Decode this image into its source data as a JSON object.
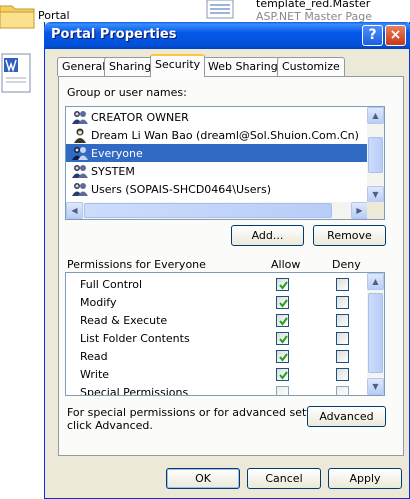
{
  "background": {
    "folder_label": "Portal",
    "file_name": "template_red.Master",
    "file_type": "ASP.NET Master Page"
  },
  "dialog": {
    "title": "Portal Properties",
    "help_glyph": "?",
    "close_glyph": "×"
  },
  "tabs": [
    {
      "label": "General",
      "active": false
    },
    {
      "label": "Sharing",
      "active": false
    },
    {
      "label": "Security",
      "active": true
    },
    {
      "label": "Web Sharing",
      "active": false
    },
    {
      "label": "Customize",
      "active": false
    }
  ],
  "security": {
    "group_label": "Group or user names:",
    "users": [
      {
        "name": "CREATOR OWNER",
        "icon": "users-group-icon",
        "selected": false
      },
      {
        "name": "Dream Li Wan Bao (dreaml@Sol.Shuion.Com.Cn)",
        "icon": "user-icon",
        "selected": false
      },
      {
        "name": "Everyone",
        "icon": "users-group-icon",
        "selected": true
      },
      {
        "name": "SYSTEM",
        "icon": "users-group-icon",
        "selected": false
      },
      {
        "name": "Users (SOPAIS-SHCD0464\\Users)",
        "icon": "users-group-icon",
        "selected": false
      }
    ],
    "add_button": "Add...",
    "remove_button": "Remove",
    "permissions_label": "Permissions for Everyone",
    "allow_header": "Allow",
    "deny_header": "Deny",
    "permissions": [
      {
        "name": "Full Control",
        "allow": true,
        "deny": false
      },
      {
        "name": "Modify",
        "allow": true,
        "deny": false
      },
      {
        "name": "Read & Execute",
        "allow": true,
        "deny": false
      },
      {
        "name": "List Folder Contents",
        "allow": true,
        "deny": false
      },
      {
        "name": "Read",
        "allow": true,
        "deny": false
      },
      {
        "name": "Write",
        "allow": true,
        "deny": false
      },
      {
        "name": "Special Permissions",
        "allow": false,
        "deny": false
      }
    ],
    "special_note_line1": "For special permissions or for advanced settings,",
    "special_note_line2": "click Advanced.",
    "advanced_button": "Advanced"
  },
  "footer": {
    "ok_button": "OK",
    "cancel_button": "Cancel",
    "apply_button": "Apply"
  },
  "colors": {
    "titlebar": "#0458e8",
    "selection": "#316ac5",
    "dialog_face": "#ece9d8",
    "tab_highlight": "#ffc73c",
    "checkmark": "#21a121"
  }
}
